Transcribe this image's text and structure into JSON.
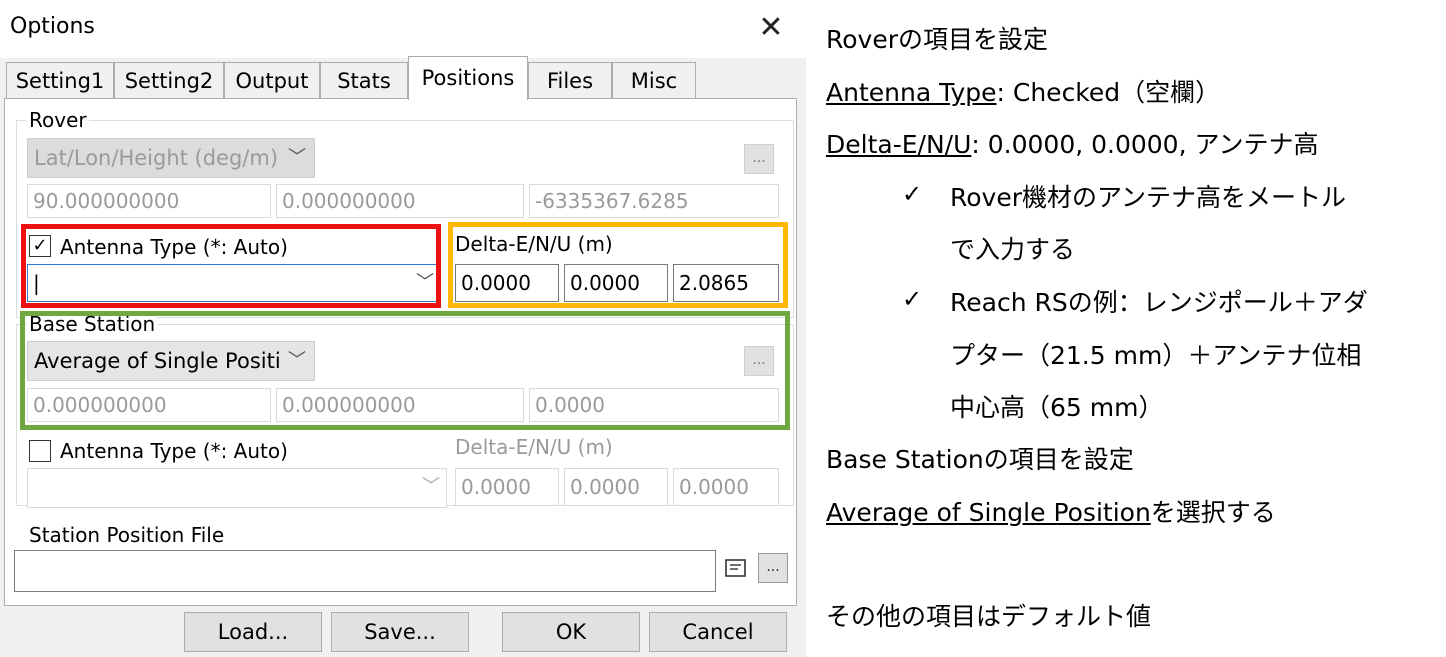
{
  "window": {
    "title": "Options",
    "close_glyph": "✕"
  },
  "tabs": [
    "Setting1",
    "Setting2",
    "Output",
    "Stats",
    "Positions",
    "Files",
    "Misc"
  ],
  "active_tab": "Positions",
  "rover": {
    "group_label": "Rover",
    "format": "Lat/Lon/Height (deg/m)",
    "values": [
      "90.000000000",
      "0.000000000",
      "-6335367.6285"
    ],
    "antenna_checkbox_label": "Antenna Type (*: Auto)",
    "antenna_checked": true,
    "antenna_value": "|",
    "delta_label": "Delta-E/N/U (m)",
    "delta_values": [
      "0.0000",
      "0.0000",
      "2.0865"
    ]
  },
  "base": {
    "group_label": "Base Station",
    "format": "Average of Single Positi",
    "values": [
      "0.000000000",
      "0.000000000",
      "0.0000"
    ],
    "antenna_checkbox_label": "Antenna Type (*: Auto)",
    "antenna_checked": false,
    "delta_label": "Delta-E/N/U (m)",
    "delta_values": [
      "0.0000",
      "0.0000",
      "0.0000"
    ]
  },
  "station_file_label": "Station Position File",
  "dots": "...",
  "buttons": {
    "load": "Load...",
    "save": "Save...",
    "ok": "OK",
    "cancel": "Cancel"
  },
  "highlight_colors": {
    "red": "#ee1111",
    "orange": "#ffb700",
    "green": "#6fa840"
  },
  "notes": {
    "line1": "Roverの項目を設定",
    "line2_u": "Antenna Type",
    "line2_rest": ": Checked（空欄）",
    "line3_u": "Delta-E/N/U",
    "line3_rest": ": 0.0000, 0.0000, アンテナ高",
    "check": "✓",
    "bullet1_a": "Rover機材のアンテナ高をメートル",
    "bullet1_b": "で入力する",
    "bullet2_a": "Reach RSの例：レンジポール＋アダ",
    "bullet2_b": "プター（21.5 mm）＋アンテナ位相",
    "bullet2_c": "中心高（65 mm）",
    "line4": "Base Stationの項目を設定",
    "line5_u": "Average of Single Position",
    "line5_rest": "を選択する",
    "line6": "その他の項目はデフォルト値"
  }
}
